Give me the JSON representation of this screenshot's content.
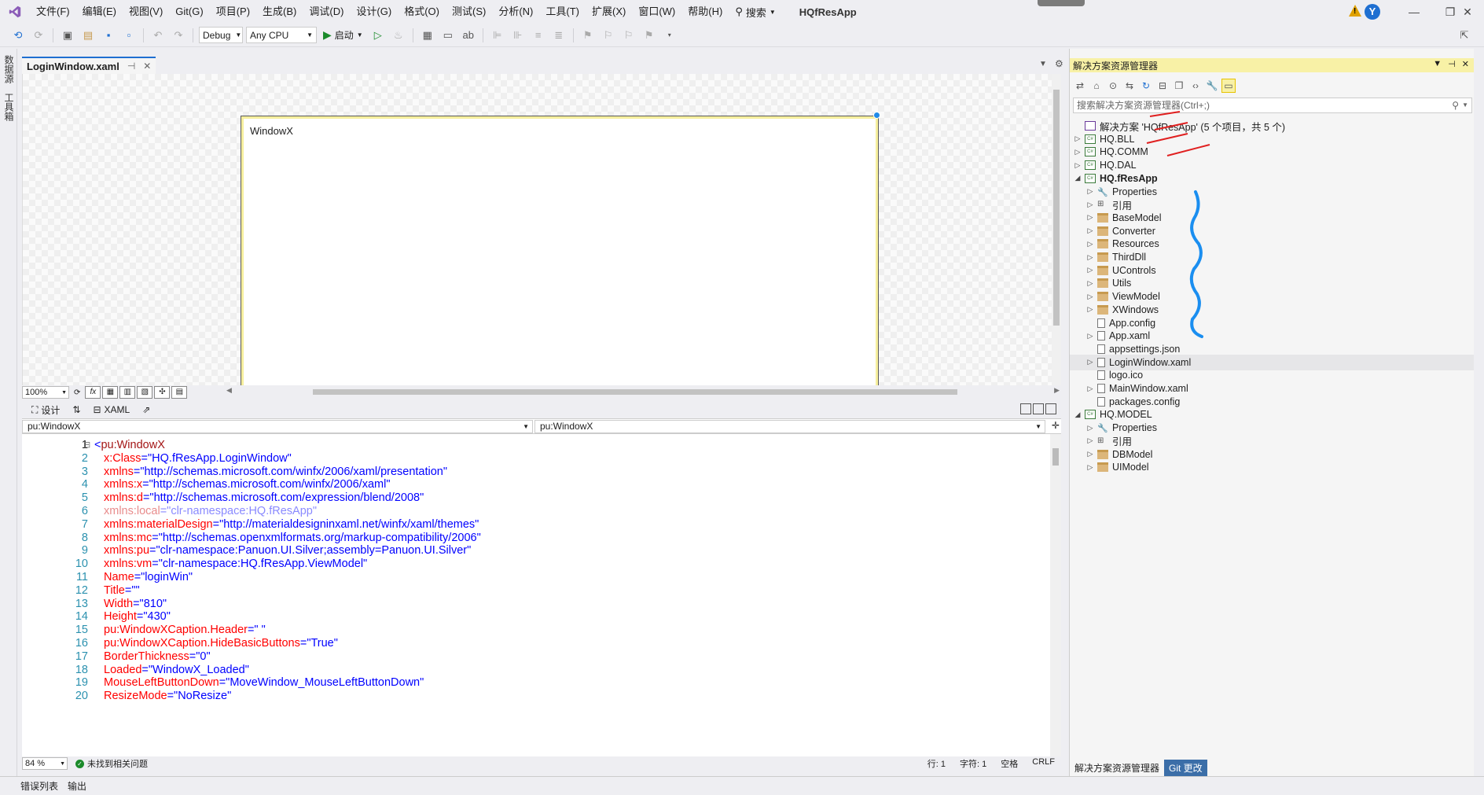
{
  "menubar": {
    "items": [
      "文件(F)",
      "编辑(E)",
      "视图(V)",
      "Git(G)",
      "项目(P)",
      "生成(B)",
      "调试(D)",
      "设计(G)",
      "格式(O)",
      "测试(S)",
      "分析(N)",
      "工具(T)",
      "扩展(X)",
      "窗口(W)",
      "帮助(H)"
    ],
    "search_label": "搜索",
    "solution_name": "HQfResApp",
    "avatar_letter": "Y"
  },
  "toolbar": {
    "config": "Debug",
    "platform": "Any CPU",
    "start_label": "启动"
  },
  "left_strip": {
    "tab1": "数据源",
    "tab2": "工具箱"
  },
  "document": {
    "tab_title": "LoginWindow.xaml",
    "preview_title": "WindowX",
    "zoom": "100%",
    "fx_label": "fx",
    "design_tab": "设计",
    "xaml_tab": "XAML",
    "nav_left": "pu:WindowX",
    "nav_right": "pu:WindowX",
    "editor_zoom": "84 %",
    "issues": "未找到相关问题",
    "row": "行: 1",
    "col": "字符: 1",
    "whitespace": "空格",
    "line_ending": "CRLF"
  },
  "code_lines": [
    {
      "num": "1",
      "parts": [
        {
          "t": "<",
          "c": "bracket"
        },
        {
          "t": "pu:WindowX",
          "c": "tag"
        }
      ]
    },
    {
      "num": "2",
      "parts": [
        {
          "t": "x:Class",
          "c": "attr"
        },
        {
          "t": "=\"HQ.fResApp.LoginWindow\"",
          "c": "val"
        }
      ]
    },
    {
      "num": "3",
      "parts": [
        {
          "t": "xmlns",
          "c": "attr"
        },
        {
          "t": "=\"http://schemas.microsoft.com/winfx/2006/xaml/presentation\"",
          "c": "val"
        }
      ]
    },
    {
      "num": "4",
      "parts": [
        {
          "t": "xmlns:x",
          "c": "attr"
        },
        {
          "t": "=\"http://schemas.microsoft.com/winfx/2006/xaml\"",
          "c": "val"
        }
      ]
    },
    {
      "num": "5",
      "parts": [
        {
          "t": "xmlns:d",
          "c": "attr"
        },
        {
          "t": "=\"http://schemas.microsoft.com/expression/blend/2008\"",
          "c": "val"
        }
      ]
    },
    {
      "num": "6",
      "parts": [
        {
          "t": "xmlns:local",
          "c": "dim-attr"
        },
        {
          "t": "=\"clr-namespace:HQ.fResApp\"",
          "c": "dim-val"
        }
      ]
    },
    {
      "num": "7",
      "parts": [
        {
          "t": "xmlns:materialDesign",
          "c": "attr"
        },
        {
          "t": "=\"http://materialdesigninxaml.net/winfx/xaml/themes\"",
          "c": "val"
        }
      ]
    },
    {
      "num": "8",
      "parts": [
        {
          "t": "xmlns:mc",
          "c": "attr"
        },
        {
          "t": "=\"http://schemas.openxmlformats.org/markup-compatibility/2006\"",
          "c": "val"
        }
      ]
    },
    {
      "num": "9",
      "parts": [
        {
          "t": "xmlns:pu",
          "c": "attr"
        },
        {
          "t": "=\"clr-namespace:Panuon.UI.Silver;assembly=Panuon.UI.Silver\"",
          "c": "val"
        }
      ]
    },
    {
      "num": "10",
      "parts": [
        {
          "t": "xmlns:vm",
          "c": "attr"
        },
        {
          "t": "=\"clr-namespace:HQ.fResApp.ViewModel\"",
          "c": "val"
        }
      ]
    },
    {
      "num": "11",
      "parts": [
        {
          "t": "Name",
          "c": "attr"
        },
        {
          "t": "=\"loginWin\"",
          "c": "val"
        }
      ]
    },
    {
      "num": "12",
      "parts": [
        {
          "t": "Title",
          "c": "attr"
        },
        {
          "t": "=\"\"",
          "c": "val"
        }
      ]
    },
    {
      "num": "13",
      "parts": [
        {
          "t": "Width",
          "c": "attr"
        },
        {
          "t": "=\"810\"",
          "c": "val"
        }
      ]
    },
    {
      "num": "14",
      "parts": [
        {
          "t": "Height",
          "c": "attr"
        },
        {
          "t": "=\"430\"",
          "c": "val"
        }
      ]
    },
    {
      "num": "15",
      "parts": [
        {
          "t": "pu:WindowXCaption.Header",
          "c": "attr"
        },
        {
          "t": "=\" \"",
          "c": "val"
        }
      ]
    },
    {
      "num": "16",
      "parts": [
        {
          "t": "pu:WindowXCaption.HideBasicButtons",
          "c": "attr"
        },
        {
          "t": "=\"True\"",
          "c": "val"
        }
      ]
    },
    {
      "num": "17",
      "parts": [
        {
          "t": "BorderThickness",
          "c": "attr"
        },
        {
          "t": "=\"0\"",
          "c": "val"
        }
      ]
    },
    {
      "num": "18",
      "parts": [
        {
          "t": "Loaded",
          "c": "attr"
        },
        {
          "t": "=\"WindowX_Loaded\"",
          "c": "val"
        }
      ]
    },
    {
      "num": "19",
      "parts": [
        {
          "t": "MouseLeftButtonDown",
          "c": "attr"
        },
        {
          "t": "=\"MoveWindow_MouseLeftButtonDown\"",
          "c": "val"
        }
      ]
    },
    {
      "num": "20",
      "parts": [
        {
          "t": "ResizeMode",
          "c": "attr"
        },
        {
          "t": "=\"NoResize\"",
          "c": "val"
        }
      ]
    }
  ],
  "explorer": {
    "title": "解决方案资源管理器",
    "search_placeholder": "搜索解决方案资源管理器(Ctrl+;)",
    "tree": [
      {
        "label": "解决方案 'HQfResApp' (5 个项目，共 5 个)",
        "level": 0,
        "icon": "solution",
        "expander": "",
        "bold": false
      },
      {
        "label": "HQ.BLL",
        "level": 0,
        "icon": "cs",
        "expander": "▷",
        "bold": false
      },
      {
        "label": "HQ.COMM",
        "level": 0,
        "icon": "cs",
        "expander": "▷",
        "bold": false
      },
      {
        "label": "HQ.DAL",
        "level": 0,
        "icon": "cs",
        "expander": "▷",
        "bold": false
      },
      {
        "label": "HQ.fResApp",
        "level": 0,
        "icon": "cs",
        "expander": "◢",
        "bold": true
      },
      {
        "label": "Properties",
        "level": 1,
        "icon": "wrench",
        "expander": "▷",
        "bold": false
      },
      {
        "label": "引用",
        "level": 1,
        "icon": "ref",
        "expander": "▷",
        "bold": false
      },
      {
        "label": "BaseModel",
        "level": 1,
        "icon": "folder",
        "expander": "▷",
        "bold": false
      },
      {
        "label": "Converter",
        "level": 1,
        "icon": "folder",
        "expander": "▷",
        "bold": false
      },
      {
        "label": "Resources",
        "level": 1,
        "icon": "folder",
        "expander": "▷",
        "bold": false
      },
      {
        "label": "ThirdDll",
        "level": 1,
        "icon": "folder",
        "expander": "▷",
        "bold": false
      },
      {
        "label": "UControls",
        "level": 1,
        "icon": "folder",
        "expander": "▷",
        "bold": false
      },
      {
        "label": "Utils",
        "level": 1,
        "icon": "folder",
        "expander": "▷",
        "bold": false
      },
      {
        "label": "ViewModel",
        "level": 1,
        "icon": "folder",
        "expander": "▷",
        "bold": false
      },
      {
        "label": "XWindows",
        "level": 1,
        "icon": "folder",
        "expander": "▷",
        "bold": false
      },
      {
        "label": "App.config",
        "level": 1,
        "icon": "file",
        "expander": "",
        "bold": false
      },
      {
        "label": "App.xaml",
        "level": 1,
        "icon": "file",
        "expander": "▷",
        "bold": false
      },
      {
        "label": "appsettings.json",
        "level": 1,
        "icon": "file",
        "expander": "",
        "bold": false
      },
      {
        "label": "LoginWindow.xaml",
        "level": 1,
        "icon": "file",
        "expander": "▷",
        "bold": false,
        "selected": true
      },
      {
        "label": "logo.ico",
        "level": 1,
        "icon": "file",
        "expander": "",
        "bold": false
      },
      {
        "label": "MainWindow.xaml",
        "level": 1,
        "icon": "file",
        "expander": "▷",
        "bold": false
      },
      {
        "label": "packages.config",
        "level": 1,
        "icon": "file",
        "expander": "",
        "bold": false
      },
      {
        "label": "HQ.MODEL",
        "level": 0,
        "icon": "cs",
        "expander": "◢",
        "bold": false
      },
      {
        "label": "Properties",
        "level": 1,
        "icon": "wrench",
        "expander": "▷",
        "bold": false
      },
      {
        "label": "引用",
        "level": 1,
        "icon": "ref",
        "expander": "▷",
        "bold": false
      },
      {
        "label": "DBModel",
        "level": 1,
        "icon": "folder",
        "expander": "▷",
        "bold": false
      },
      {
        "label": "UIModel",
        "level": 1,
        "icon": "folder",
        "expander": "▷",
        "bold": false
      }
    ],
    "bottom_tab_active": "解决方案资源管理器",
    "bottom_tab_other": "Git 更改"
  },
  "bottom_bar": {
    "tab1": "错误列表",
    "tab2": "输出"
  },
  "colors": {
    "accent": "#1f6fd1",
    "annotation_red": "#e02020",
    "annotation_blue": "#1a8ef0"
  }
}
